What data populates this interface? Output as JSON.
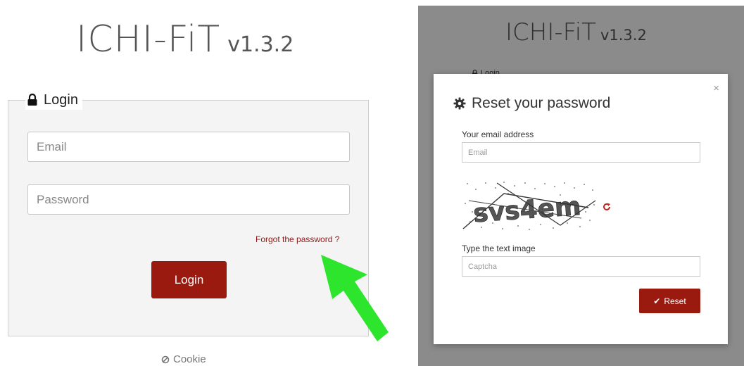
{
  "login_page": {
    "app_name": "ICHI-FiT",
    "version": "v1.3.2",
    "legend": "Login",
    "email_placeholder": "Email",
    "password_placeholder": "Password",
    "forgot_link": "Forgot the password ?",
    "login_button": "Login",
    "cookie_link": "Cookie",
    "arrow_color": "#2ee52e"
  },
  "reset_page": {
    "app_name": "ICHI-FiT",
    "version": "v1.3.2",
    "login_peek": "Login",
    "modal": {
      "close": "×",
      "title": "Reset your password",
      "email_label": "Your email address",
      "email_placeholder": "Email",
      "captcha_text": "svs4em",
      "captcha_label": "Type the text image",
      "captcha_placeholder": "Captcha",
      "reset_button": "Reset"
    }
  },
  "colors": {
    "brand_red": "#9b1a10",
    "link_red": "#8b1a1a",
    "overlay_gray": "#8b8b8b"
  }
}
